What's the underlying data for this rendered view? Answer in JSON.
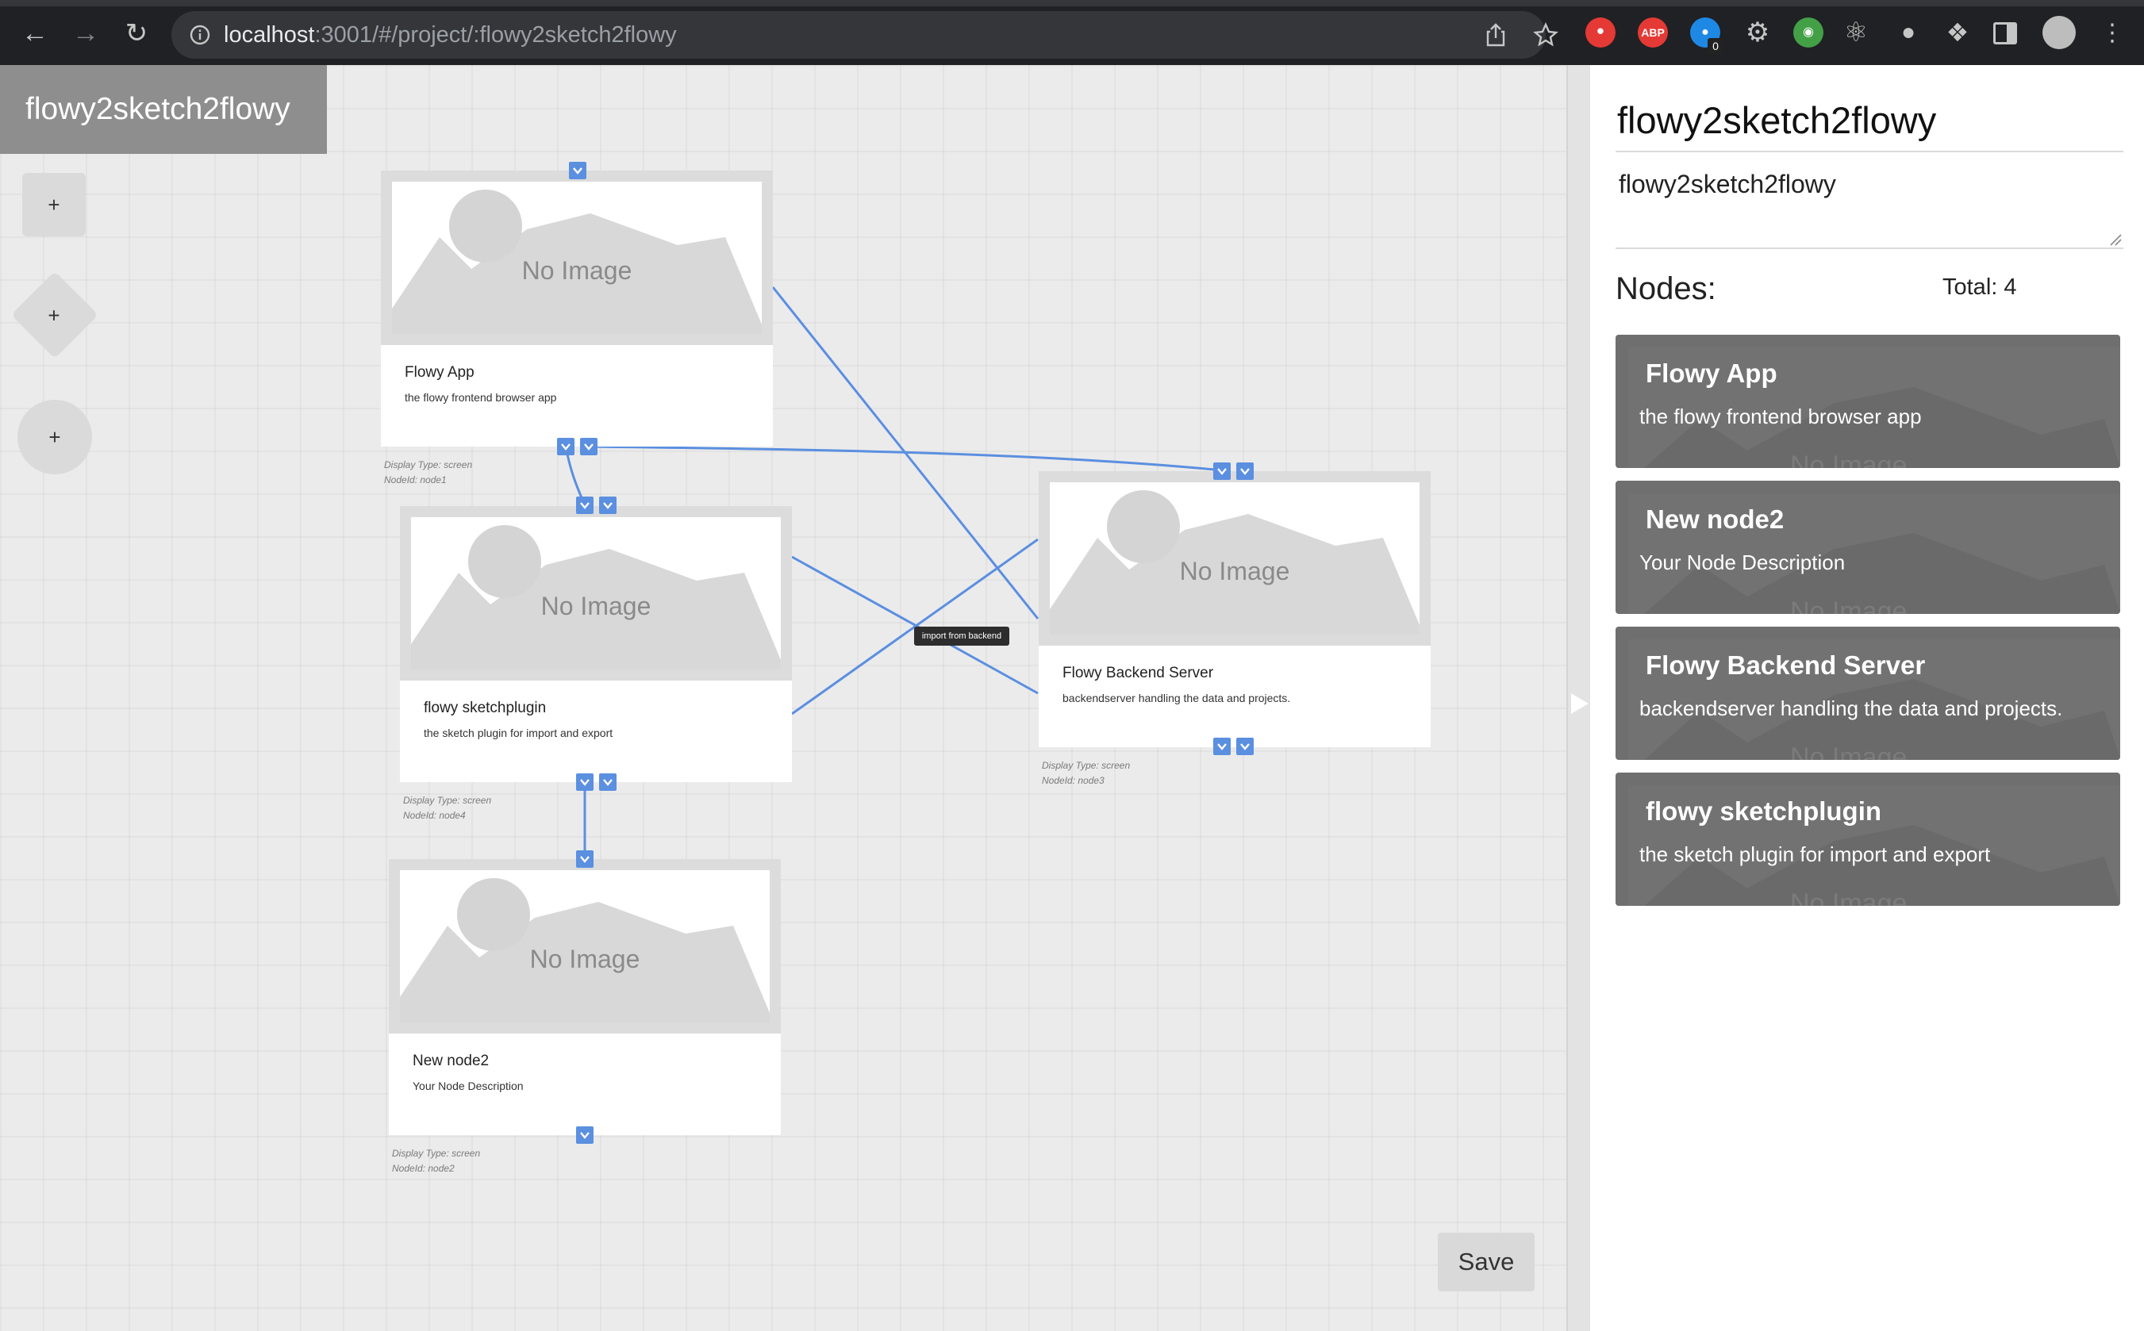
{
  "browser": {
    "url_host": "localhost",
    "url_path": ":3001/#/project/:flowy2sketch2flowy",
    "extension_badge_count": "0"
  },
  "project": {
    "tab_title": "flowy2sketch2flowy"
  },
  "toolbar": {
    "add_rect_label": "+",
    "add_diamond_label": "+",
    "add_circle_label": "+"
  },
  "nodes": [
    {
      "title": "Flowy App",
      "description": "the flowy frontend browser app",
      "display_type": "Display Type: screen",
      "node_id": "NodeId: node1",
      "placeholder": "No Image"
    },
    {
      "title": "flowy sketchplugin",
      "description": "the sketch plugin for import and export",
      "display_type": "Display Type: screen",
      "node_id": "NodeId: node4",
      "placeholder": "No Image"
    },
    {
      "title": "New node2",
      "description": "Your Node Description",
      "display_type": "Display Type: screen",
      "node_id": "NodeId: node2",
      "placeholder": "No Image"
    },
    {
      "title": "Flowy Backend Server",
      "description": "backendserver handling the data and projects.",
      "display_type": "Display Type: screen",
      "node_id": "NodeId: node3",
      "placeholder": "No Image"
    }
  ],
  "edge_label": "import from backend",
  "save_label": "Save",
  "panel": {
    "title": "flowy2sketch2flowy",
    "description": "flowy2sketch2flowy",
    "nodes_heading": "Nodes:",
    "total": "Total: 4",
    "ghost_text": "No Image",
    "list": [
      {
        "title": "Flowy App",
        "description": "the flowy frontend browser app"
      },
      {
        "title": "New node2",
        "description": "Your Node Description"
      },
      {
        "title": "Flowy Backend Server",
        "description": "backendserver handling the data and projects."
      },
      {
        "title": "flowy sketchplugin",
        "description": "the sketch plugin for import and export"
      }
    ]
  },
  "colors": {
    "accent": "#5b8fe0",
    "edge": "#5b8fe0",
    "panel_card": "#6f6f6f"
  }
}
